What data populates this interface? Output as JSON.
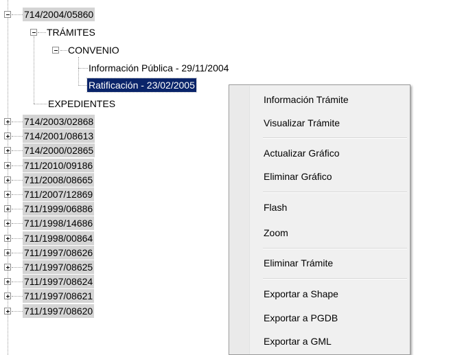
{
  "tree": {
    "root": "714/2004/05860",
    "tramites": "TRÁMITES",
    "convenio": "CONVENIO",
    "leaf1": "Información Pública - 29/11/2004",
    "leaf2": "Ratificación - 23/02/2005",
    "expedientes": "EXPEDIENTES",
    "nodes": [
      "714/2003/02868",
      "714/2001/08613",
      "714/2000/02865",
      "711/2010/09186",
      "711/2008/08665",
      "711/2007/12869",
      "711/1999/06886",
      "711/1998/14686",
      "711/1998/00864",
      "711/1997/08626",
      "711/1997/08625",
      "711/1997/08624",
      "711/1997/08621",
      "711/1997/08620"
    ]
  },
  "menu": {
    "info": "Información Trámite",
    "ver": "Visualizar Trámite",
    "actualizar": "Actualizar Gráfico",
    "eliminar_graf": "Eliminar Gráfico",
    "flash": "Flash",
    "zoom": "Zoom",
    "eliminar_tram": "Eliminar Trámite",
    "shape": "Exportar a Shape",
    "pgdb": "Exportar a PGDB",
    "gml": "Exportar a GML"
  }
}
